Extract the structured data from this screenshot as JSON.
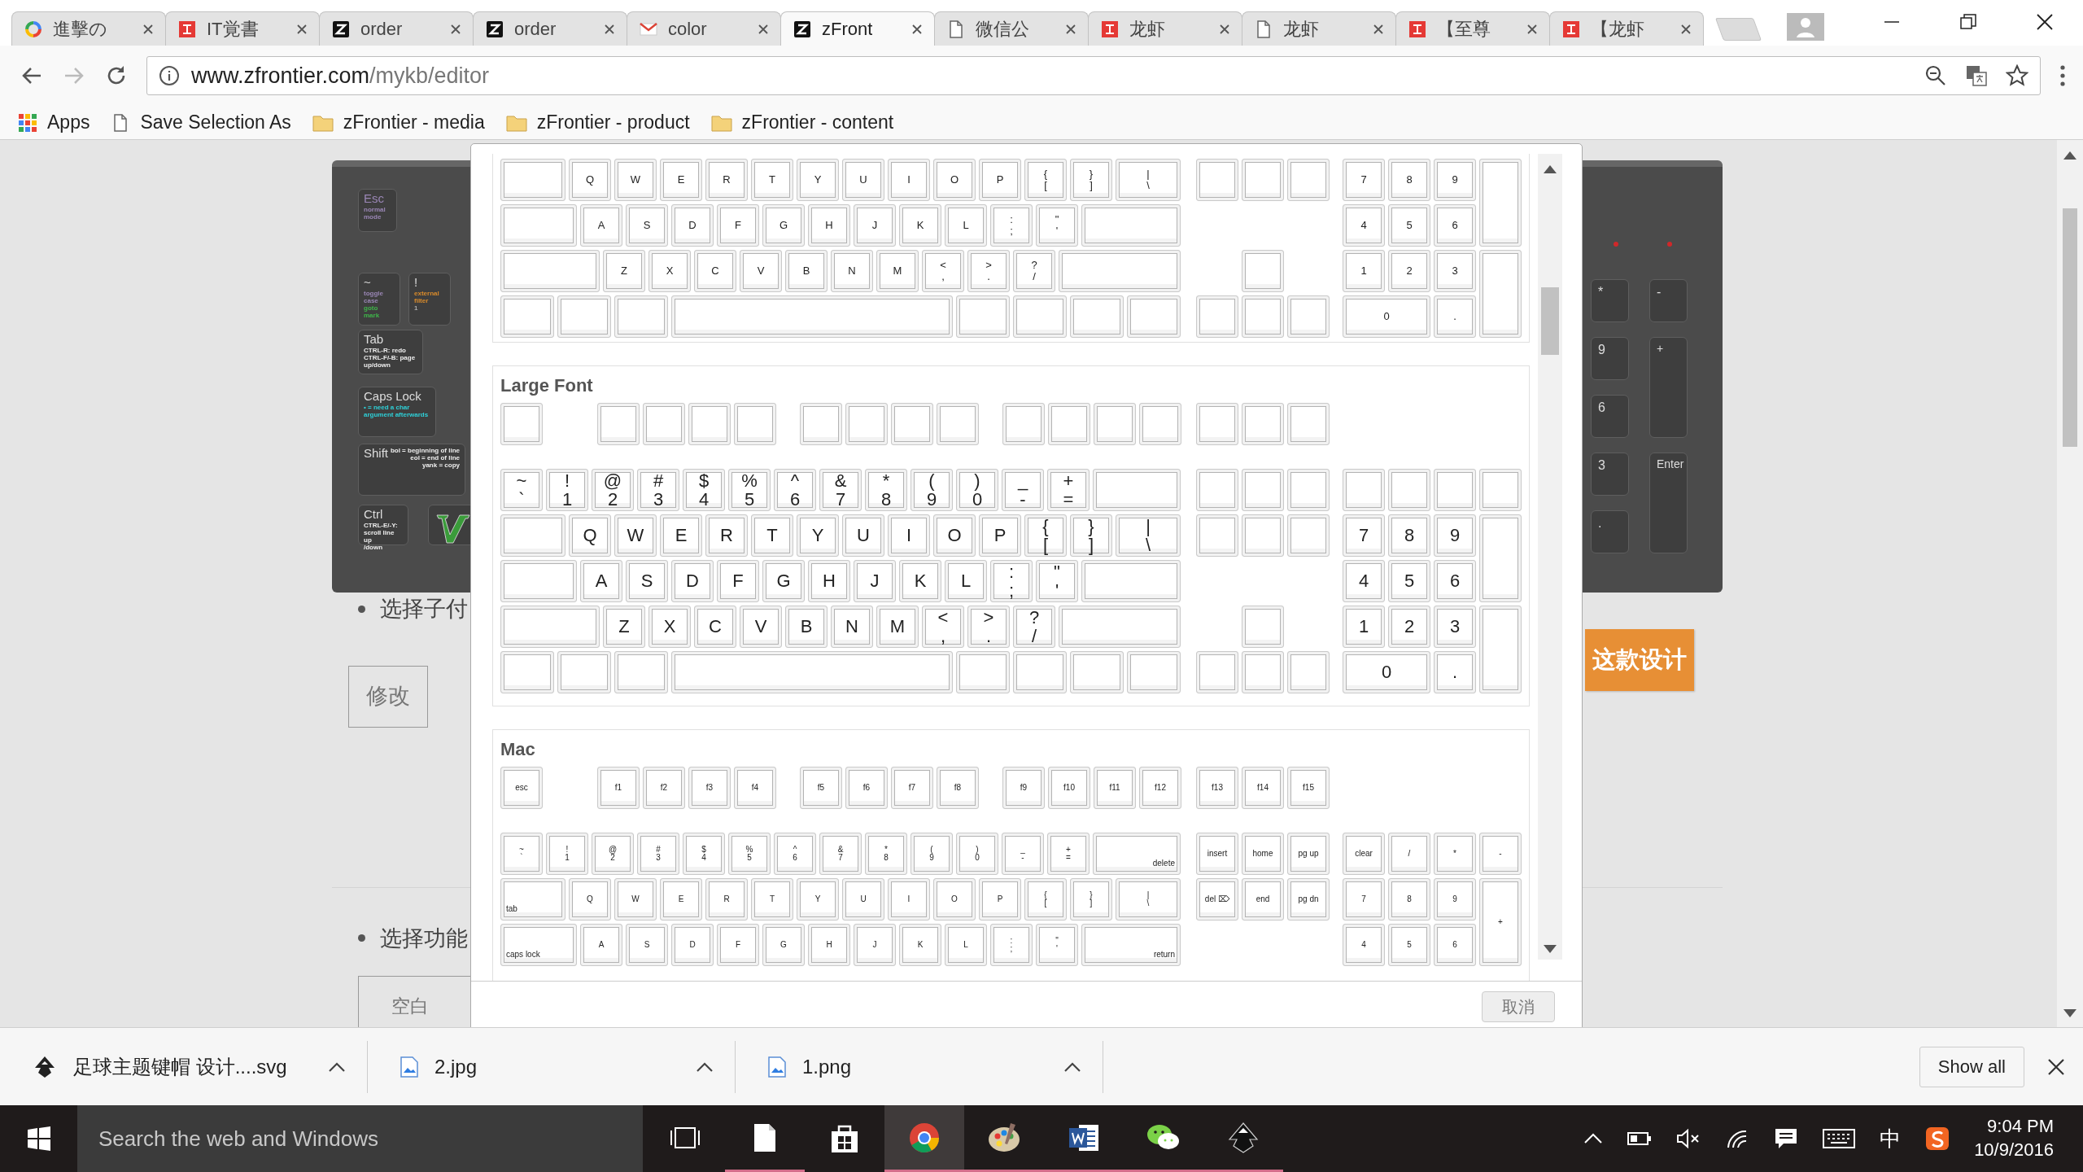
{
  "browser": {
    "tabs": [
      {
        "title": "進擊の",
        "kind": "google",
        "selected": false
      },
      {
        "title": "IT覚書",
        "kind": "red",
        "selected": false
      },
      {
        "title": "order",
        "kind": "z",
        "selected": false
      },
      {
        "title": "order",
        "kind": "z",
        "selected": false
      },
      {
        "title": "color",
        "kind": "gmail",
        "selected": false
      },
      {
        "title": "zFront",
        "kind": "z",
        "selected": true
      },
      {
        "title": "微信公",
        "kind": "page",
        "selected": false
      },
      {
        "title": "龙虾",
        "kind": "red",
        "selected": false
      },
      {
        "title": "龙虾",
        "kind": "page",
        "selected": false
      },
      {
        "title": "【至尊",
        "kind": "red",
        "selected": false
      },
      {
        "title": "【龙虾",
        "kind": "red",
        "selected": false
      }
    ],
    "address": {
      "host": "www.zfrontier.com",
      "path": "/mykb/editor"
    },
    "bookmarks": [
      {
        "label": "Apps",
        "kind": "apps"
      },
      {
        "label": "Save Selection As",
        "kind": "page"
      },
      {
        "label": "zFrontier - media",
        "kind": "folder"
      },
      {
        "label": "zFrontier - product",
        "kind": "folder"
      },
      {
        "label": "zFrontier - content",
        "kind": "folder"
      }
    ]
  },
  "page": {
    "keyboard_image": {
      "left_rows": [
        [
          {
            "kind": "esc",
            "title": "Esc",
            "notes": [
              {
                "text": "normal\nmode",
                "color": "#9a86b5"
              }
            ]
          }
        ],
        [
          {
            "kind": "small",
            "title": "~",
            "notes": [
              {
                "text": "toggle\ncase",
                "color": "#9a86b5"
              },
              {
                "text": "goto mark",
                "color": "#3fb44a"
              }
            ]
          },
          {
            "kind": "small",
            "title": "!",
            "notes": [
              {
                "text": "external\nfilter",
                "color": "#d98b2b"
              },
              {
                "text": "1",
                "color": "#aaaaaa"
              }
            ]
          }
        ],
        [
          {
            "kind": "tab",
            "title": "Tab",
            "notes": [
              {
                "text": "CTRL-R: redo\nCTRL-F/-B: page\nup/down",
                "color": "#eeeeee"
              }
            ]
          }
        ],
        [
          {
            "kind": "caps",
            "title": "Caps Lock",
            "notes": [
              {
                "text": "• = need a char\nargument afterwards",
                "color": "#2ed0d8"
              }
            ]
          }
        ],
        [
          {
            "kind": "shift",
            "title": "Shift",
            "notes": [
              {
                "text": "bol = beginning of line\neol = end of line\nyank = copy",
                "color": "#eeeeee"
              }
            ]
          }
        ],
        [
          {
            "kind": "ctrl",
            "title": "Ctrl",
            "notes": [
              {
                "text": "CTRL-E/-Y:\nscroll line up\n/down",
                "color": "#eeeeee"
              }
            ]
          }
        ]
      ],
      "right_keys": [
        {
          "kind": "key",
          "label": "*"
        },
        {
          "kind": "key",
          "label": "-"
        },
        {
          "kind": "key",
          "label": "9"
        },
        {
          "kind": "tall",
          "label": "+"
        },
        {
          "kind": "key",
          "label": "6"
        },
        {
          "kind": "key",
          "label": "3"
        },
        {
          "kind": "tall",
          "label": "Enter"
        },
        {
          "kind": "key",
          "label": "."
        }
      ]
    },
    "item_1": {
      "text": "选择子付",
      "button": "修改"
    },
    "design_button": "这款设计",
    "item_2": {
      "text": "选择功能",
      "field_value": "空白"
    }
  },
  "modal": {
    "sections": [
      {
        "kind": "standard",
        "rows": [
          {
            "main": [
              {
                "kind": "tab"
              },
              {
                "kind": "key",
                "label": "Q"
              },
              {
                "kind": "key",
                "label": "W"
              },
              {
                "kind": "key",
                "label": "E"
              },
              {
                "kind": "key",
                "label": "R"
              },
              {
                "kind": "key",
                "label": "T"
              },
              {
                "kind": "key",
                "label": "Y"
              },
              {
                "kind": "key",
                "label": "U"
              },
              {
                "kind": "key",
                "label": "I"
              },
              {
                "kind": "key",
                "label": "O"
              },
              {
                "kind": "key",
                "label": "P"
              },
              {
                "kind": "key",
                "label": "{\n["
              },
              {
                "kind": "key",
                "label": "}\n]"
              },
              {
                "kind": "backslash",
                "label": "|\n\\"
              }
            ],
            "nav": [
              {
                "kind": "key"
              },
              {
                "kind": "key"
              },
              {
                "kind": "key"
              }
            ],
            "num": [
              {
                "kind": "key",
                "label": "7"
              },
              {
                "kind": "key",
                "label": "8"
              },
              {
                "kind": "key",
                "label": "9"
              },
              {
                "kind": "tall"
              }
            ]
          },
          {
            "main": [
              {
                "kind": "caps"
              },
              {
                "kind": "key",
                "label": "A"
              },
              {
                "kind": "key",
                "label": "S"
              },
              {
                "kind": "key",
                "label": "D"
              },
              {
                "kind": "key",
                "label": "F"
              },
              {
                "kind": "key",
                "label": "G"
              },
              {
                "kind": "key",
                "label": "H"
              },
              {
                "kind": "key",
                "label": "J"
              },
              {
                "kind": "key",
                "label": "K"
              },
              {
                "kind": "key",
                "label": "L"
              },
              {
                "kind": "key",
                "label": ":\n;"
              },
              {
                "kind": "key",
                "label": "\"\n'"
              },
              {
                "kind": "enter"
              }
            ],
            "num": [
              {
                "kind": "key",
                "label": "4"
              },
              {
                "kind": "key",
                "label": "5"
              },
              {
                "kind": "key",
                "label": "6"
              }
            ]
          },
          {
            "main": [
              {
                "kind": "shift"
              },
              {
                "kind": "key",
                "label": "Z"
              },
              {
                "kind": "key",
                "label": "X"
              },
              {
                "kind": "key",
                "label": "C"
              },
              {
                "kind": "key",
                "label": "V"
              },
              {
                "kind": "key",
                "label": "B"
              },
              {
                "kind": "key",
                "label": "N"
              },
              {
                "kind": "key",
                "label": "M"
              },
              {
                "kind": "key",
                "label": "<\n,"
              },
              {
                "kind": "key",
                "label": ">\n."
              },
              {
                "kind": "key",
                "label": "?\n/"
              },
              {
                "kind": "rshift"
              }
            ],
            "nav": [
              {
                "kind": "key"
              }
            ],
            "num": [
              {
                "kind": "key",
                "label": "1"
              },
              {
                "kind": "key",
                "label": "2"
              },
              {
                "kind": "key",
                "label": "3"
              },
              {
                "kind": "tall"
              }
            ]
          },
          {
            "main": [
              {
                "kind": "mod"
              },
              {
                "kind": "mod"
              },
              {
                "kind": "mod"
              },
              {
                "kind": "space"
              },
              {
                "kind": "mod"
              },
              {
                "kind": "mod"
              },
              {
                "kind": "mod"
              },
              {
                "kind": "mod"
              }
            ],
            "nav": [
              {
                "kind": "key"
              },
              {
                "kind": "key"
              },
              {
                "kind": "key"
              }
            ],
            "num": [
              {
                "kind": "wide",
                "label": "0"
              },
              {
                "kind": "key",
                "label": "."
              }
            ]
          }
        ]
      },
      {
        "kind": "large",
        "title": "Large Font",
        "fn_row": {
          "groups": [
            [
              {
                "kind": "key"
              }
            ],
            [
              {
                "kind": "key"
              },
              {
                "kind": "key"
              },
              {
                "kind": "key"
              },
              {
                "kind": "key"
              }
            ],
            [
              {
                "kind": "key"
              },
              {
                "kind": "key"
              },
              {
                "kind": "key"
              },
              {
                "kind": "key"
              }
            ],
            [
              {
                "kind": "key"
              },
              {
                "kind": "key"
              },
              {
                "kind": "key"
              },
              {
                "kind": "key"
              }
            ]
          ],
          "nav": [
            {
              "kind": "key"
            },
            {
              "kind": "key"
            },
            {
              "kind": "key"
            }
          ]
        },
        "rows": [
          {
            "main": [
              {
                "kind": "key",
                "label": "~\n`"
              },
              {
                "kind": "key",
                "label": "!\n1"
              },
              {
                "kind": "key",
                "label": "@\n2"
              },
              {
                "kind": "key",
                "label": "#\n3"
              },
              {
                "kind": "key",
                "label": "$\n4"
              },
              {
                "kind": "key",
                "label": "%\n5"
              },
              {
                "kind": "key",
                "label": "^\n6"
              },
              {
                "kind": "key",
                "label": "&\n7"
              },
              {
                "kind": "key",
                "label": "*\n8"
              },
              {
                "kind": "key",
                "label": "(\n9"
              },
              {
                "kind": "key",
                "label": ")\n0"
              },
              {
                "kind": "key",
                "label": "_\n-"
              },
              {
                "kind": "key",
                "label": "+\n="
              },
              {
                "kind": "backspace"
              }
            ],
            "nav": [
              {
                "kind": "key"
              },
              {
                "kind": "key"
              },
              {
                "kind": "key"
              }
            ],
            "num": [
              {
                "kind": "key"
              },
              {
                "kind": "key"
              },
              {
                "kind": "key"
              },
              {
                "kind": "key"
              }
            ]
          },
          {
            "main": [
              {
                "kind": "tab"
              },
              {
                "kind": "key",
                "label": "Q"
              },
              {
                "kind": "key",
                "label": "W"
              },
              {
                "kind": "key",
                "label": "E"
              },
              {
                "kind": "key",
                "label": "R"
              },
              {
                "kind": "key",
                "label": "T"
              },
              {
                "kind": "key",
                "label": "Y"
              },
              {
                "kind": "key",
                "label": "U"
              },
              {
                "kind": "key",
                "label": "I"
              },
              {
                "kind": "key",
                "label": "O"
              },
              {
                "kind": "key",
                "label": "P"
              },
              {
                "kind": "key",
                "label": "{\n["
              },
              {
                "kind": "key",
                "label": "}\n]"
              },
              {
                "kind": "backslash",
                "label": "|\n\\"
              }
            ],
            "nav": [
              {
                "kind": "key"
              },
              {
                "kind": "key"
              },
              {
                "kind": "key"
              }
            ],
            "num": [
              {
                "kind": "key",
                "label": "7"
              },
              {
                "kind": "key",
                "label": "8"
              },
              {
                "kind": "key",
                "label": "9"
              },
              {
                "kind": "tall"
              }
            ]
          },
          {
            "main": [
              {
                "kind": "caps"
              },
              {
                "kind": "key",
                "label": "A"
              },
              {
                "kind": "key",
                "label": "S"
              },
              {
                "kind": "key",
                "label": "D"
              },
              {
                "kind": "key",
                "label": "F"
              },
              {
                "kind": "key",
                "label": "G"
              },
              {
                "kind": "key",
                "label": "H"
              },
              {
                "kind": "key",
                "label": "J"
              },
              {
                "kind": "key",
                "label": "K"
              },
              {
                "kind": "key",
                "label": "L"
              },
              {
                "kind": "key",
                "label": ":\n;"
              },
              {
                "kind": "key",
                "label": "\"\n'"
              },
              {
                "kind": "enter"
              }
            ],
            "num": [
              {
                "kind": "key",
                "label": "4"
              },
              {
                "kind": "key",
                "label": "5"
              },
              {
                "kind": "key",
                "label": "6"
              }
            ]
          },
          {
            "main": [
              {
                "kind": "shift"
              },
              {
                "kind": "key",
                "label": "Z"
              },
              {
                "kind": "key",
                "label": "X"
              },
              {
                "kind": "key",
                "label": "C"
              },
              {
                "kind": "key",
                "label": "V"
              },
              {
                "kind": "key",
                "label": "B"
              },
              {
                "kind": "key",
                "label": "N"
              },
              {
                "kind": "key",
                "label": "M"
              },
              {
                "kind": "key",
                "label": "<\n,"
              },
              {
                "kind": "key",
                "label": ">\n."
              },
              {
                "kind": "key",
                "label": "?\n/"
              },
              {
                "kind": "rshift"
              }
            ],
            "nav": [
              {
                "kind": "key"
              }
            ],
            "num": [
              {
                "kind": "key",
                "label": "1"
              },
              {
                "kind": "key",
                "label": "2"
              },
              {
                "kind": "key",
                "label": "3"
              },
              {
                "kind": "tall"
              }
            ]
          },
          {
            "main": [
              {
                "kind": "mod"
              },
              {
                "kind": "mod"
              },
              {
                "kind": "mod"
              },
              {
                "kind": "space"
              },
              {
                "kind": "mod"
              },
              {
                "kind": "mod"
              },
              {
                "kind": "mod"
              },
              {
                "kind": "mod"
              }
            ],
            "nav": [
              {
                "kind": "key"
              },
              {
                "kind": "key"
              },
              {
                "kind": "key"
              }
            ],
            "num": [
              {
                "kind": "wide",
                "label": "0"
              },
              {
                "kind": "key",
                "label": "."
              }
            ]
          }
        ]
      },
      {
        "kind": "mac",
        "title": "Mac",
        "fn_row": {
          "groups": [
            [
              {
                "kind": "key",
                "label": "esc"
              }
            ],
            [
              {
                "kind": "key",
                "label": "f1"
              },
              {
                "kind": "key",
                "label": "f2"
              },
              {
                "kind": "key",
                "label": "f3"
              },
              {
                "kind": "key",
                "label": "f4"
              }
            ],
            [
              {
                "kind": "key",
                "label": "f5"
              },
              {
                "kind": "key",
                "label": "f6"
              },
              {
                "kind": "key",
                "label": "f7"
              },
              {
                "kind": "key",
                "label": "f8"
              }
            ],
            [
              {
                "kind": "key",
                "label": "f9"
              },
              {
                "kind": "key",
                "label": "f10"
              },
              {
                "kind": "key",
                "label": "f11"
              },
              {
                "kind": "key",
                "label": "f12"
              }
            ]
          ],
          "nav": [
            {
              "kind": "key",
              "label": "f13"
            },
            {
              "kind": "key",
              "label": "f14"
            },
            {
              "kind": "key",
              "label": "f15"
            }
          ]
        },
        "rows": [
          {
            "main": [
              {
                "kind": "key",
                "label": "~\n`"
              },
              {
                "kind": "key",
                "label": "!\n1"
              },
              {
                "kind": "key",
                "label": "@\n2"
              },
              {
                "kind": "key",
                "label": "#\n3"
              },
              {
                "kind": "key",
                "label": "$\n4"
              },
              {
                "kind": "key",
                "label": "%\n5"
              },
              {
                "kind": "key",
                "label": "^\n6"
              },
              {
                "kind": "key",
                "label": "&\n7"
              },
              {
                "kind": "key",
                "label": "*\n8"
              },
              {
                "kind": "key",
                "label": "(\n9"
              },
              {
                "kind": "key",
                "label": ")\n0"
              },
              {
                "kind": "key",
                "label": "_\n-"
              },
              {
                "kind": "key",
                "label": "+\n="
              },
              {
                "kind": "backspace",
                "label": "delete"
              }
            ],
            "nav": [
              {
                "kind": "key",
                "label": "insert"
              },
              {
                "kind": "key",
                "label": "home"
              },
              {
                "kind": "key",
                "label": "pg up"
              }
            ],
            "num": [
              {
                "kind": "key",
                "label": "clear"
              },
              {
                "kind": "key",
                "label": "/"
              },
              {
                "kind": "key",
                "label": "*"
              },
              {
                "kind": "key",
                "label": "-"
              }
            ]
          },
          {
            "main": [
              {
                "kind": "tab",
                "label": "tab"
              },
              {
                "kind": "key",
                "label": "Q"
              },
              {
                "kind": "key",
                "label": "W"
              },
              {
                "kind": "key",
                "label": "E"
              },
              {
                "kind": "key",
                "label": "R"
              },
              {
                "kind": "key",
                "label": "T"
              },
              {
                "kind": "key",
                "label": "Y"
              },
              {
                "kind": "key",
                "label": "U"
              },
              {
                "kind": "key",
                "label": "I"
              },
              {
                "kind": "key",
                "label": "O"
              },
              {
                "kind": "key",
                "label": "P"
              },
              {
                "kind": "key",
                "label": "{\n["
              },
              {
                "kind": "key",
                "label": "}\n]"
              },
              {
                "kind": "backslash",
                "label": "|\n\\"
              }
            ],
            "nav": [
              {
                "kind": "key",
                "label": "del ⌦"
              },
              {
                "kind": "key",
                "label": "end"
              },
              {
                "kind": "key",
                "label": "pg dn"
              }
            ],
            "num": [
              {
                "kind": "key",
                "label": "7"
              },
              {
                "kind": "key",
                "label": "8"
              },
              {
                "kind": "key",
                "label": "9"
              },
              {
                "kind": "tall",
                "label": "+"
              }
            ]
          },
          {
            "main": [
              {
                "kind": "caps",
                "label": "caps lock"
              },
              {
                "kind": "key",
                "label": "A"
              },
              {
                "kind": "key",
                "label": "S"
              },
              {
                "kind": "key",
                "label": "D"
              },
              {
                "kind": "key",
                "label": "F"
              },
              {
                "kind": "key",
                "label": "G"
              },
              {
                "kind": "key",
                "label": "H"
              },
              {
                "kind": "key",
                "label": "J"
              },
              {
                "kind": "key",
                "label": "K"
              },
              {
                "kind": "key",
                "label": "L"
              },
              {
                "kind": "key",
                "label": ":\n;"
              },
              {
                "kind": "key",
                "label": "\"\n'"
              },
              {
                "kind": "enter",
                "label": "return"
              }
            ],
            "num": [
              {
                "kind": "key",
                "label": "4"
              },
              {
                "kind": "key",
                "label": "5"
              },
              {
                "kind": "key",
                "label": "6"
              }
            ]
          }
        ]
      }
    ],
    "cancel_button": "取消"
  },
  "downloads": {
    "items": [
      {
        "name": "足球主题键帽 设计....svg",
        "kind": "vector"
      },
      {
        "name": "2.jpg",
        "kind": "image"
      },
      {
        "name": "1.png",
        "kind": "image"
      }
    ],
    "show_all": "Show all"
  },
  "taskbar": {
    "search_placeholder": "Search the web and Windows",
    "apps": [
      {
        "kind": "task-view",
        "selected": false,
        "running": false
      },
      {
        "kind": "file",
        "selected": false,
        "running": true
      },
      {
        "kind": "store",
        "selected": false,
        "running": false
      },
      {
        "kind": "chrome",
        "selected": true,
        "running": true
      },
      {
        "kind": "paint",
        "selected": false,
        "running": true
      },
      {
        "kind": "word",
        "selected": false,
        "running": true
      },
      {
        "kind": "wechat",
        "selected": false,
        "running": true
      },
      {
        "kind": "inkscape",
        "selected": false,
        "running": true
      }
    ],
    "ime": "中",
    "time": "9:04 PM",
    "date": "10/9/2016"
  }
}
